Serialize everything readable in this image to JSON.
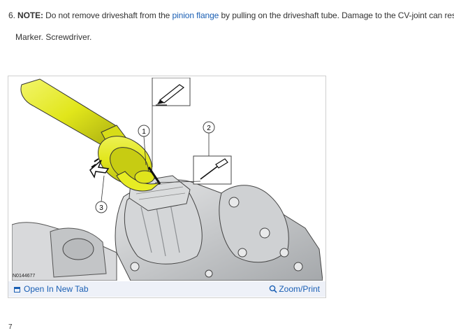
{
  "step": {
    "number": "6.",
    "note_label": "NOTE:",
    "text_before_link": "Do not remove driveshaft from the",
    "link_text": "pinion flange",
    "text_after_link": "by pulling on the driveshaft tube. Damage to the CV-joint can result."
  },
  "tools_text": "Marker. Screwdriver.",
  "figure": {
    "image_id": "N0144677",
    "callouts": [
      "1",
      "2",
      "3"
    ],
    "open_tab_label": "Open In New Tab",
    "zoom_label": "Zoom/Print"
  },
  "next_step_number": "7",
  "colors": {
    "link": "#1a5fb4",
    "driveshaft": "#e4ea1c",
    "housing": "#c9cbcd",
    "toolbar_bg": "#eef1f8"
  },
  "icons": [
    "open-in-new-tab-icon",
    "magnifier-icon",
    "marker-icon",
    "screwdriver-icon"
  ]
}
